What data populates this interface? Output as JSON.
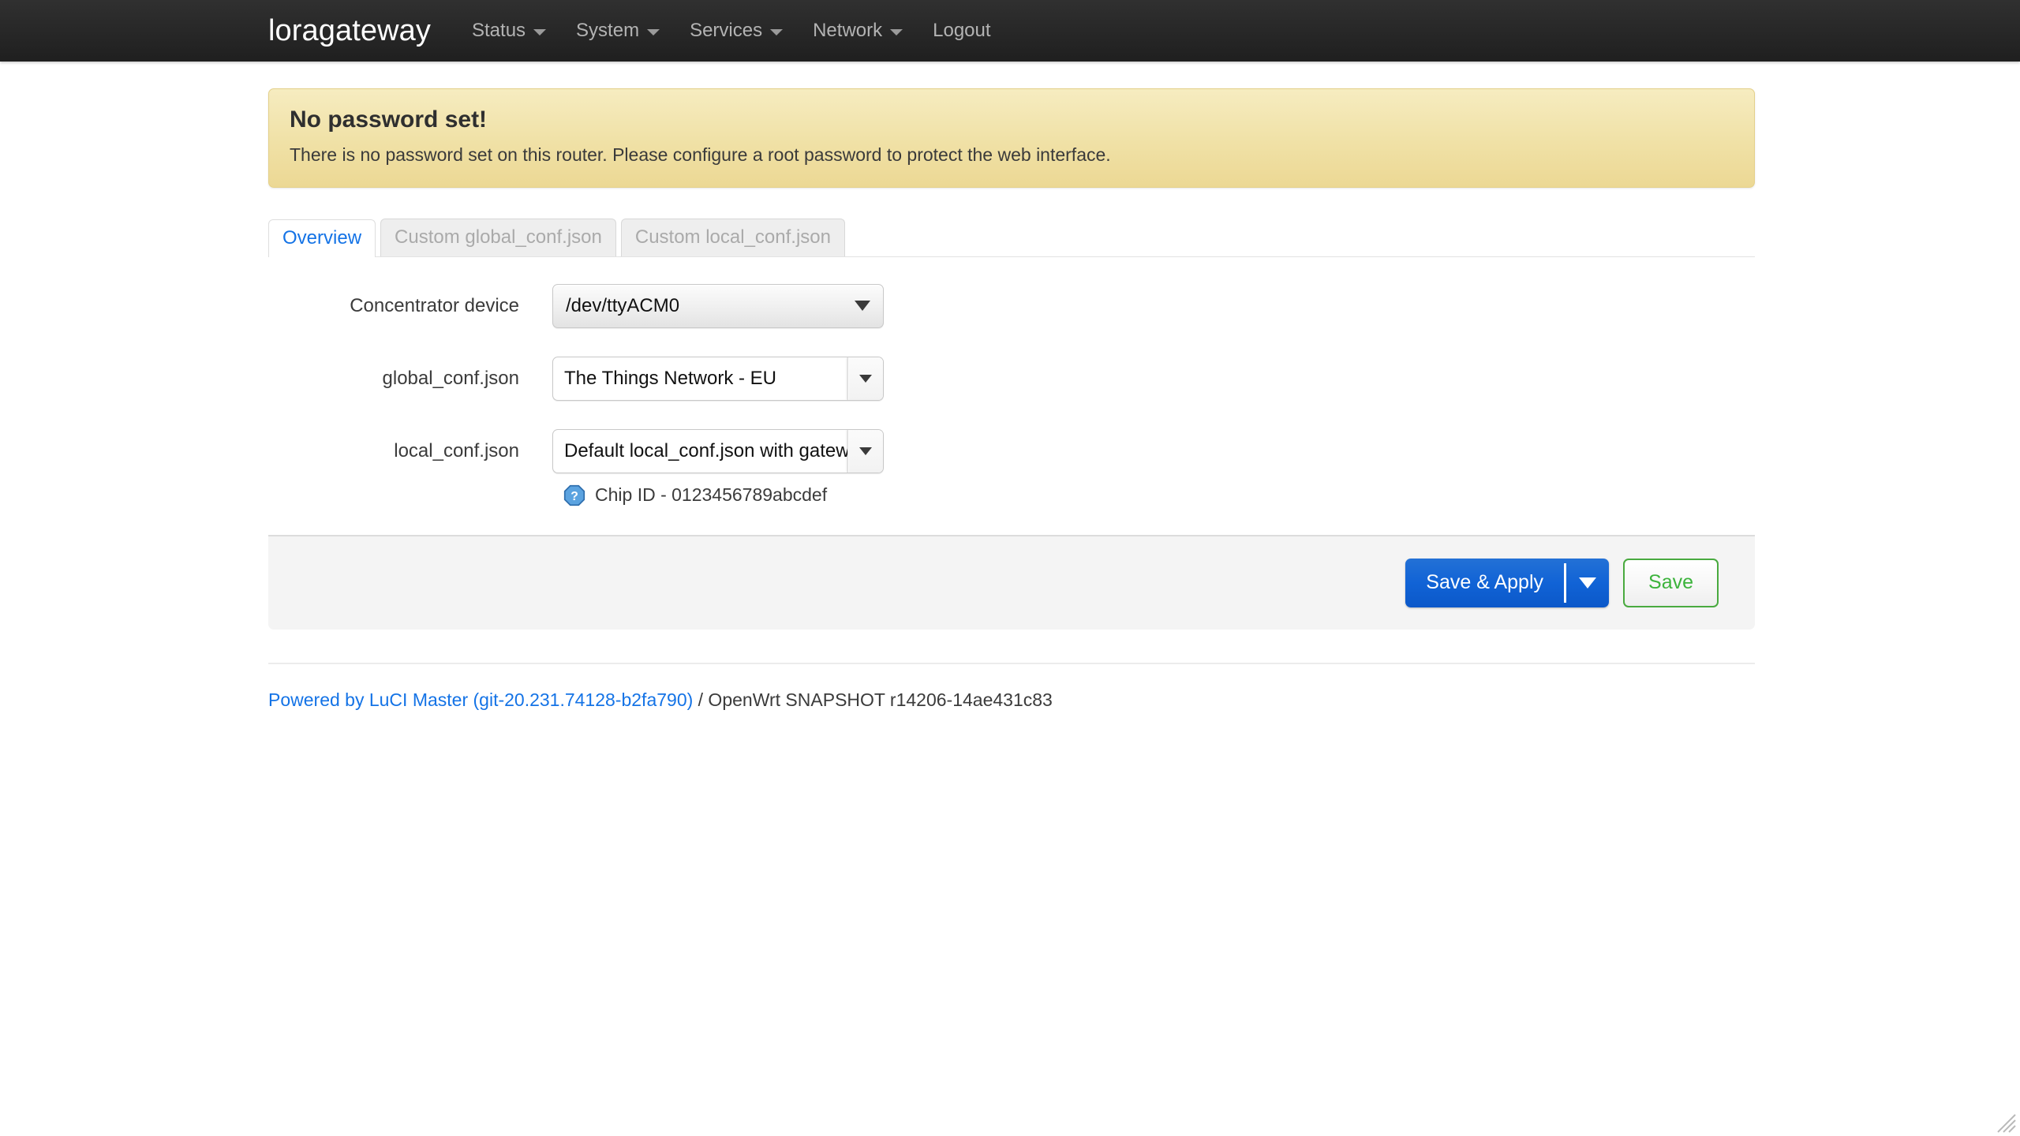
{
  "navbar": {
    "brand": "loragateway",
    "items": [
      {
        "label": "Status",
        "has_caret": true,
        "icon": "chevron-down-icon"
      },
      {
        "label": "System",
        "has_caret": true,
        "icon": "chevron-down-icon"
      },
      {
        "label": "Services",
        "has_caret": true,
        "icon": "chevron-down-icon"
      },
      {
        "label": "Network",
        "has_caret": true,
        "icon": "chevron-down-icon"
      },
      {
        "label": "Logout",
        "has_caret": false,
        "icon": ""
      }
    ]
  },
  "warning": {
    "title": "No password set!",
    "text": "There is no password set on this router. Please configure a root password to protect the web interface."
  },
  "tabs": [
    {
      "label": "Overview",
      "active": true
    },
    {
      "label": "Custom global_conf.json",
      "active": false
    },
    {
      "label": "Custom local_conf.json",
      "active": false
    }
  ],
  "form": {
    "fields": [
      {
        "label": "Concentrator device",
        "value": "/dev/ttyACM0",
        "style": "grey",
        "arrow_icon": "caret-down-icon"
      },
      {
        "label": "global_conf.json",
        "value": "The Things Network - EU",
        "style": "white",
        "arrow_icon": "caret-down-icon"
      },
      {
        "label": "local_conf.json",
        "value": "Default local_conf.json with gatew",
        "style": "white",
        "arrow_icon": "caret-down-icon",
        "hint": {
          "icon": "help-question-icon",
          "text": "Chip ID - 0123456789abcdef"
        }
      }
    ]
  },
  "actions": {
    "save_apply_label": "Save & Apply",
    "dropdown_icon": "caret-down-icon",
    "save_label": "Save"
  },
  "footer": {
    "link_text": "Powered by LuCI Master (git-20.231.74128-b2fa790)",
    "rest_text": " / OpenWrt SNAPSHOT r14206-14ae431c83"
  },
  "colors": {
    "navbar_bg": "#262626",
    "brand_text": "#ffffff",
    "nav_link": "#b3b3b3",
    "warning_bg": "#f0e1a6",
    "warning_border": "#e4d08a",
    "tab_active_text": "#1473e6",
    "tab_inactive_text": "#aaaaaa",
    "primary_button": "#1163d6",
    "save_button_border": "#49aa3f",
    "save_button_text": "#3cb33c",
    "link": "#1473e6",
    "actionbar_bg": "#f4f4f4"
  }
}
